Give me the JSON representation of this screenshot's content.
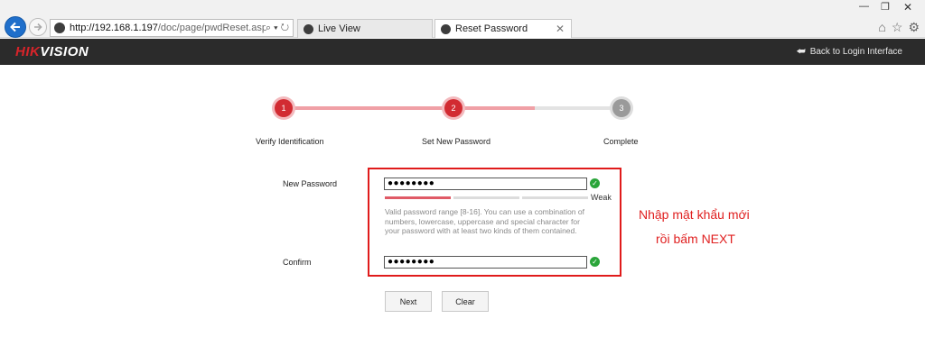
{
  "browser": {
    "url_host": "http://192.168.1.197",
    "url_path": "/doc/page/pwdReset.asp",
    "addr_actions": "⌕ ▾ ↻",
    "tabs": [
      {
        "label": "Live View"
      },
      {
        "label": "Reset Password",
        "close": "✕"
      }
    ],
    "window_controls": [
      "—",
      "❐",
      "✕"
    ],
    "toolbar_icons": [
      "⌂",
      "☆",
      "⚙"
    ]
  },
  "header": {
    "logo_red": "HIK",
    "logo_white": "VISION",
    "back_link": "Back to Login Interface"
  },
  "steps": [
    {
      "number": "1",
      "label": "Verify Identification",
      "state": "done"
    },
    {
      "number": "2",
      "label": "Set New Password",
      "state": "active"
    },
    {
      "number": "3",
      "label": "Complete",
      "state": "pending"
    }
  ],
  "form": {
    "new_password_label": "New Password",
    "new_password_value": "●●●●●●●●",
    "strength_label": "Weak",
    "strength_level": "1/3",
    "hint": "Valid password range [8-16]. You can use a combination of numbers, lowercase, uppercase and special character for your password with at least two kinds of them contained.",
    "confirm_label": "Confirm",
    "confirm_value": "●●●●●●●●"
  },
  "buttons": {
    "next": "Next",
    "clear": "Clear"
  },
  "annotation": {
    "line1": "Nhập mật khẩu mới",
    "line2": "rồi bấm NEXT"
  },
  "colors": {
    "accent_red": "#d22b32",
    "annotation_red": "#e01b1b",
    "valid_green": "#2aa53a"
  }
}
